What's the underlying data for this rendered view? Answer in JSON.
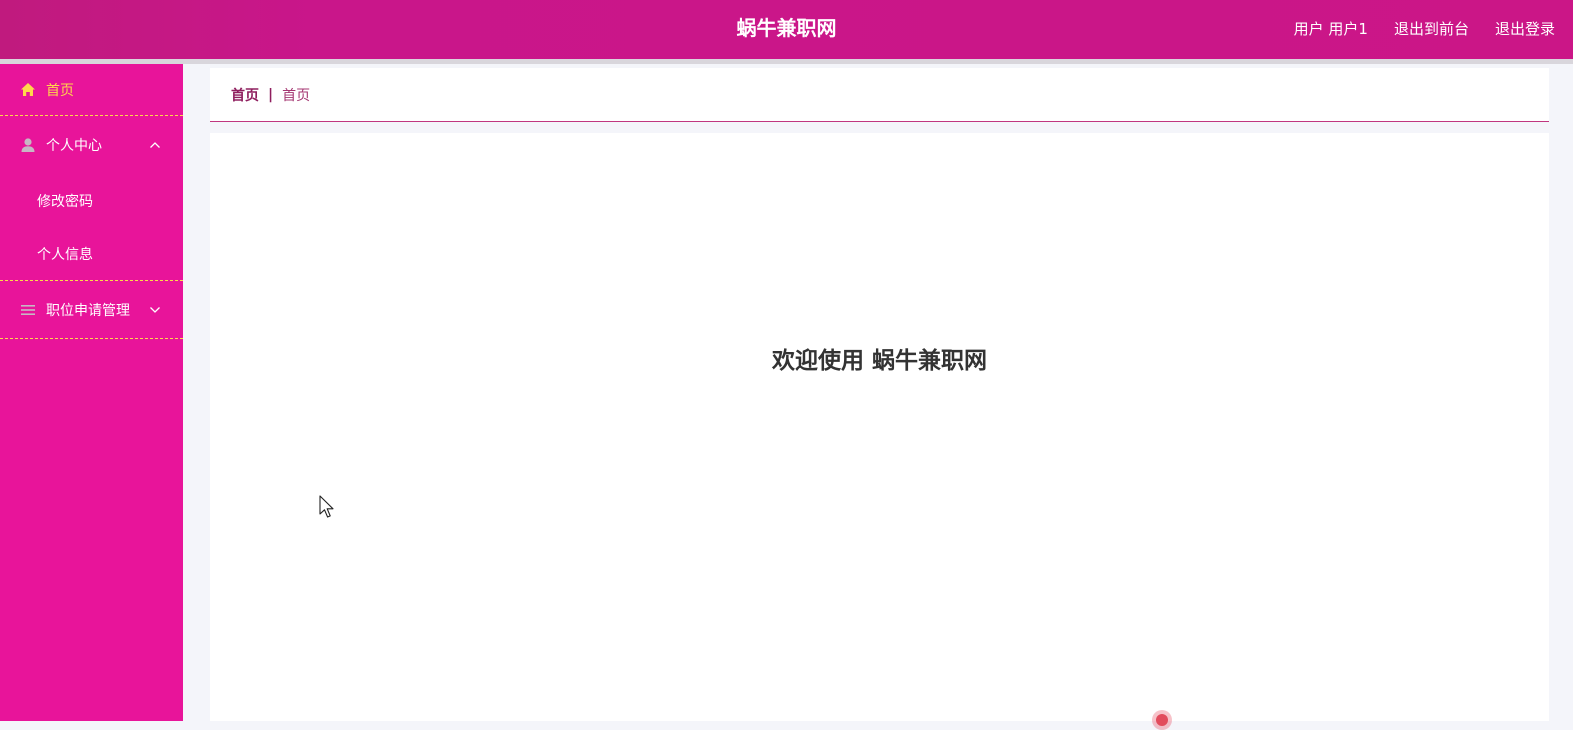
{
  "header": {
    "site_title": "蜗牛兼职网",
    "user_label": "用户 用户1",
    "exit_to_front": "退出到前台",
    "logout": "退出登录"
  },
  "sidebar": {
    "home": "首页",
    "personal_center": {
      "label": "个人中心",
      "children": [
        "修改密码",
        "个人信息"
      ]
    },
    "job_application": {
      "label": "职位申请管理"
    }
  },
  "breadcrumb": {
    "home": "首页",
    "separator": "|",
    "current": "首页"
  },
  "main": {
    "welcome_text": "欢迎使用 蜗牛兼职网"
  },
  "colors": {
    "topbar": "#cb1687",
    "sidebar": "#e8149a",
    "active_menu": "#ffd84a"
  }
}
